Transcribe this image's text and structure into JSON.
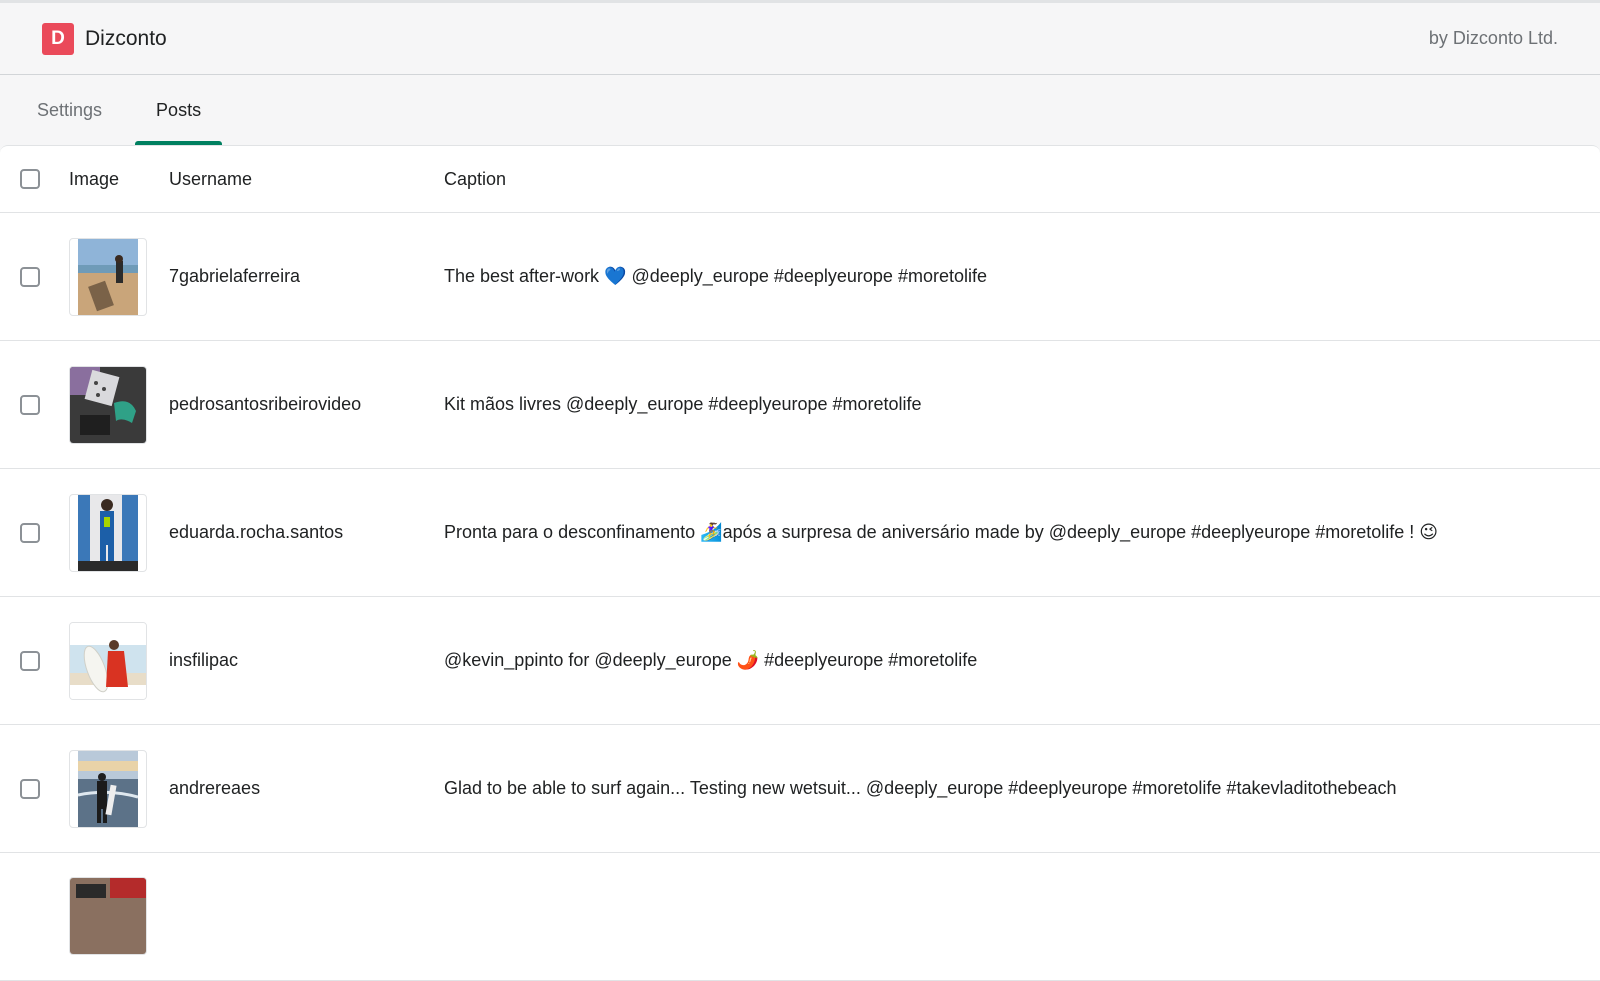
{
  "header": {
    "logo_letter": "D",
    "app_name": "Dizconto",
    "company": "by Dizconto Ltd."
  },
  "tabs": [
    {
      "label": "Settings",
      "active": false
    },
    {
      "label": "Posts",
      "active": true
    }
  ],
  "table": {
    "columns": [
      "Image",
      "Username",
      "Caption"
    ],
    "rows": [
      {
        "username": "7gabrielaferreira",
        "caption": "The best after-work 💙 @deeply_europe #deeplyeurope #moretolife"
      },
      {
        "username": "pedrosantosribeirovideo",
        "caption": "Kit mãos livres @deeply_europe #deeplyeurope #moretolife"
      },
      {
        "username": "eduarda.rocha.santos",
        "caption": "Pronta para o desconfinamento 🏄‍♀️após a surpresa de aniversário made by @deeply_europe #deeplyeurope #moretolife ! 😉"
      },
      {
        "username": "insfilipac",
        "caption": "@kevin_ppinto for @deeply_europe 🌶️ #deeplyeurope #moretolife"
      },
      {
        "username": "andrereaes",
        "caption": "Glad to be able to surf again... Testing new wetsuit... @deeply_europe #deeplyeurope #moretolife #takevladitothebeach"
      }
    ]
  },
  "colors": {
    "accent_tab_underline": "#008060",
    "logo_background": "#ea4a5a"
  }
}
